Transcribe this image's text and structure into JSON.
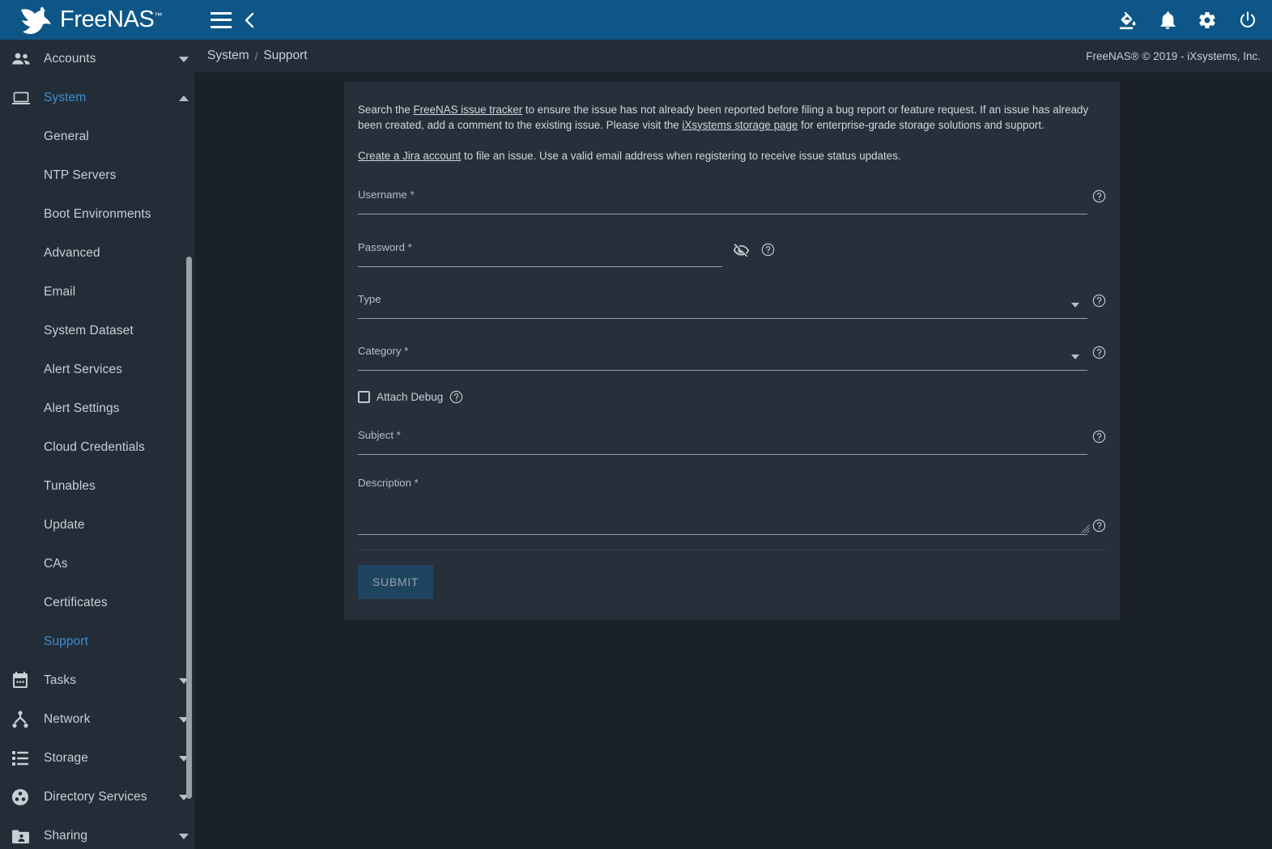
{
  "app": {
    "brand_name": "FreeNAS",
    "brand_tm": "™"
  },
  "topbar": {
    "menu_icon": "hamburger-menu-icon",
    "back_icon": "chevron-left-icon",
    "actions": [
      {
        "name": "theme-picker-icon",
        "label": "format-paint-icon"
      },
      {
        "name": "notifications-icon",
        "label": "bell-icon"
      },
      {
        "name": "settings-icon",
        "label": "gear-icon"
      },
      {
        "name": "power-icon",
        "label": "power-icon"
      }
    ]
  },
  "breadcrumb": {
    "parent": "System",
    "separator": "/",
    "current": "Support",
    "copyright": "FreeNAS® © 2019 - iXsystems, Inc."
  },
  "sidebar": {
    "groups": [
      {
        "label": "Accounts",
        "icon": "people-icon",
        "expanded": false,
        "active": false
      },
      {
        "label": "System",
        "icon": "laptop-icon",
        "expanded": true,
        "active": true
      }
    ],
    "system_items": [
      {
        "label": "General",
        "active": false
      },
      {
        "label": "NTP Servers",
        "active": false
      },
      {
        "label": "Boot Environments",
        "active": false
      },
      {
        "label": "Advanced",
        "active": false
      },
      {
        "label": "Email",
        "active": false
      },
      {
        "label": "System Dataset",
        "active": false
      },
      {
        "label": "Alert Services",
        "active": false
      },
      {
        "label": "Alert Settings",
        "active": false
      },
      {
        "label": "Cloud Credentials",
        "active": false
      },
      {
        "label": "Tunables",
        "active": false
      },
      {
        "label": "Update",
        "active": false
      },
      {
        "label": "CAs",
        "active": false
      },
      {
        "label": "Certificates",
        "active": false
      },
      {
        "label": "Support",
        "active": true
      }
    ],
    "bottom_groups": [
      {
        "label": "Tasks",
        "icon": "calendar-icon"
      },
      {
        "label": "Network",
        "icon": "network-icon"
      },
      {
        "label": "Storage",
        "icon": "storage-icon"
      },
      {
        "label": "Directory Services",
        "icon": "directory-services-icon"
      },
      {
        "label": "Sharing",
        "icon": "sharing-folder-icon"
      }
    ]
  },
  "support_form": {
    "intro_1_a": "Search the ",
    "intro_1_link1": "FreeNAS issue tracker",
    "intro_1_b": " to ensure the issue has not already been reported before filing a bug report or feature request. If an issue has already been created, add a comment to the existing issue. Please visit the ",
    "intro_1_link2": "iXsystems storage page",
    "intro_1_c": " for enterprise-grade storage solutions and support.",
    "intro_2_link": "Create a Jira account",
    "intro_2_text": " to file an issue. Use a valid email address when registering to receive issue status updates.",
    "fields": {
      "username_label": "Username *",
      "username_value": "",
      "password_label": "Password *",
      "password_value": "",
      "type_label": "Type",
      "type_value": "",
      "category_label": "Category *",
      "category_value": "",
      "attach_debug_label": "Attach Debug",
      "attach_debug_checked": false,
      "subject_label": "Subject *",
      "subject_value": "",
      "description_label": "Description *",
      "description_value": ""
    },
    "submit_label": "SUBMIT",
    "submit_disabled": true
  },
  "colors": {
    "topbar": "#0d5687",
    "sidebar": "#232d38",
    "content_bg": "#1b2129",
    "card_bg": "#262f3a",
    "accent": "#3d8fd1",
    "text": "#c8ced6",
    "submit_bg": "#1f4460"
  }
}
